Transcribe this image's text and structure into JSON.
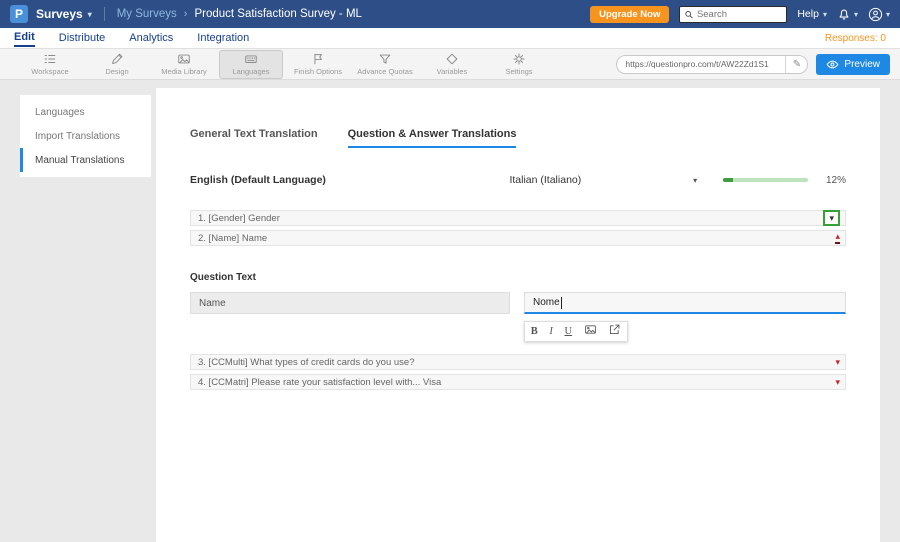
{
  "topbar": {
    "logo_letter": "P",
    "surveys_label": "Surveys",
    "breadcrumb_parent": "My Surveys",
    "breadcrumb_separator": "›",
    "breadcrumb_current": "Product Satisfaction Survey - ML",
    "upgrade_button": "Upgrade Now",
    "search_placeholder": "Search",
    "help_label": "Help"
  },
  "menu": {
    "items": [
      {
        "label": "Edit"
      },
      {
        "label": "Distribute"
      },
      {
        "label": "Analytics"
      },
      {
        "label": "Integration"
      }
    ],
    "responses_label": "Responses: 0"
  },
  "toolbar": {
    "items": [
      {
        "label": "Workspace"
      },
      {
        "label": "Design"
      },
      {
        "label": "Media Library"
      },
      {
        "label": "Languages"
      },
      {
        "label": "Finish Options"
      },
      {
        "label": "Advance Quotas"
      },
      {
        "label": "Variables"
      },
      {
        "label": "Settings"
      }
    ],
    "url_value": "https://questionpro.com/t/AW22Zd1S1",
    "preview_label": "Preview"
  },
  "sidebar": {
    "items": [
      {
        "label": "Languages"
      },
      {
        "label": "Import Translations"
      },
      {
        "label": "Manual Translations"
      }
    ]
  },
  "content": {
    "tabs": [
      {
        "label": "General Text Translation"
      },
      {
        "label": "Question & Answer Translations"
      }
    ],
    "source_language": "English (Default Language)",
    "target_language": "Italian (Italiano)",
    "progress_value": 12,
    "progress_percent": "12%",
    "questions": [
      {
        "label": "1. [Gender] Gender"
      },
      {
        "label": "2. [Name] Name"
      },
      {
        "label": "3. [CCMulti] What types of credit cards do you use?"
      },
      {
        "label": "4. [CCMatri] Please rate your satisfaction level with... Visa"
      }
    ],
    "editor": {
      "section_label": "Question Text",
      "source_value": "Name",
      "target_value": "Nome",
      "format_bold": "B",
      "format_italic": "I",
      "format_underline": "U"
    }
  },
  "icons": {
    "caret_down": "▾",
    "caret_up": "▴",
    "pencil": "✎"
  },
  "colors": {
    "topbar_bg": "#2d4e86",
    "accent_blue": "#1e88e5",
    "orange": "#f7941e",
    "green": "#3f9c3f",
    "red": "#c62828"
  }
}
